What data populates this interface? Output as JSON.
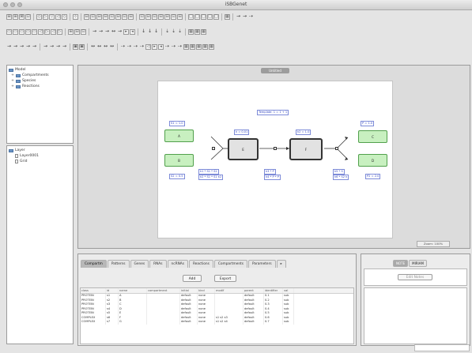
{
  "window": {
    "title": "iSBGenet"
  },
  "toolbar_rows": [
    [
      "⊞",
      "⊞",
      "⊠",
      "⊡",
      "|",
      "◇",
      "▷",
      "▽",
      "◁",
      "◇",
      "|",
      "⊹",
      "|",
      "⊟",
      "⊡",
      "⊟",
      "⊟",
      "⊡",
      "⊟",
      "⊡",
      "⊟",
      "|",
      "⊡",
      "⊟",
      "⊡",
      "⊟",
      "⊟",
      "⊡",
      "⊟",
      "|",
      "□",
      "□",
      "□",
      "□",
      "□",
      "|",
      "▦",
      "|",
      "→",
      "→",
      "⇢"
    ],
    [
      "▭",
      "▭",
      "▭",
      "▭",
      "▭",
      "◁",
      "▷",
      "◁",
      "▷",
      "|",
      "⊞",
      "⊟",
      "⊡",
      "|",
      "→",
      "→",
      "→",
      "↔",
      "→",
      "▸",
      "◂",
      "|",
      "↓",
      "↓",
      "↓",
      "|",
      "⇣",
      "⇣",
      "⇣",
      "|",
      "▦",
      "▦",
      "▦"
    ],
    [
      "→",
      "→",
      "→",
      "→",
      "→",
      "|",
      "→",
      "→",
      "→",
      "→",
      "|",
      "▣",
      "▣",
      "|",
      "↔",
      "↔",
      "↔",
      "↔",
      "|",
      "⇢",
      "⇢",
      "⇢",
      "⇢",
      "◁",
      "▸",
      "◂",
      "⇢",
      "⇢",
      "⇢",
      "▦",
      "▦",
      "▦",
      "▦",
      "▦"
    ]
  ],
  "tree_top": {
    "root": "Model",
    "items": [
      "Compartments",
      "Species",
      "Reactions"
    ]
  },
  "tree_bottom": {
    "root": "Layer",
    "items": [
      "Layer0001",
      "Grid"
    ]
  },
  "canvas": {
    "tab_label": "Untitled",
    "status": "Zoom: 100%",
    "model_label": "Template: 1 = 1 + 1",
    "nodes": {
      "g1": "A",
      "g2": "B",
      "g3": "C",
      "g4": "D",
      "p1": "E",
      "p2": "F"
    },
    "labels": {
      "l_g1": "S1 = 1.0",
      "l_g2": "S2 = 0.5",
      "l_p1": "k = 0.01",
      "l_p2": "k2 = 1.0",
      "l_g3": "P = 1.0",
      "l_g4": "P2 = 2.0",
      "l_r1": "k1 * S1 * S2",
      "l_r1b": "k2 * S1 * S1 k2",
      "l_r2": "k3 * P",
      "l_r2b": "k4 * P * P",
      "l_r3": "k5 * S",
      "l_r3b": "k6 * S2 k"
    }
  },
  "bottom": {
    "tabs": [
      "Compartm",
      "Patterns",
      "Genes",
      "RNAs",
      "ncRNAs",
      "Reactions",
      "Compartments",
      "Parameters",
      "▸"
    ],
    "active_tab": 0,
    "buttons": {
      "add": "Add",
      "export": "Export"
    },
    "columns": [
      "class",
      "id",
      "name",
      "compartment",
      "initial",
      "kind",
      "modif",
      "parent",
      "identifier",
      "val"
    ],
    "rows": [
      [
        "PROTEIN",
        "s1",
        "A",
        "",
        "default",
        "none",
        "",
        "default",
        "0.1",
        "sub"
      ],
      [
        "PROTEIN",
        "s2",
        "B",
        "",
        "default",
        "none",
        "",
        "default",
        "0.2",
        "sub"
      ],
      [
        "PROTEIN",
        "s3",
        "C",
        "",
        "default",
        "none",
        "",
        "default",
        "0.3",
        "sub"
      ],
      [
        "PROTEIN",
        "s4",
        "D",
        "",
        "default",
        "none",
        "",
        "default",
        "0.4",
        "sub"
      ],
      [
        "PROTEIN",
        "s5",
        "E",
        "",
        "default",
        "none",
        "",
        "default",
        "0.5",
        "sub"
      ],
      [
        "COMPLEX",
        "s6",
        "F",
        "",
        "default",
        "none",
        "s1 s2 s3",
        "default",
        "0.6",
        "sub"
      ],
      [
        "COMPLEX",
        "s7",
        "G",
        "",
        "default",
        "none",
        "s1 s2 s4",
        "default",
        "0.7",
        "sub"
      ]
    ]
  },
  "right_panel": {
    "tabs": [
      "NOTE",
      "MIRIAM"
    ],
    "button": "Edit Notes"
  }
}
